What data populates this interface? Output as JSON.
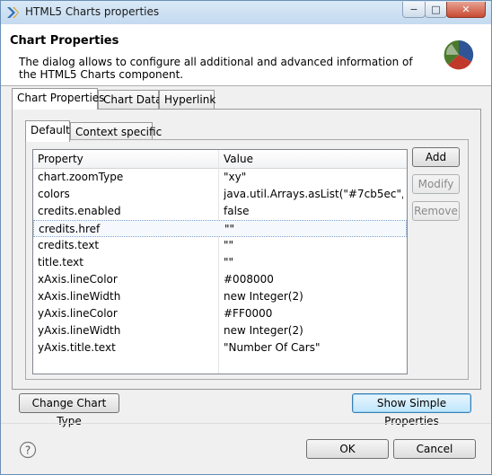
{
  "window": {
    "title": "HTML5 Charts properties",
    "minimize_label": "−",
    "maximize_label": "□",
    "close_label": "✕"
  },
  "header": {
    "title": "Chart Properties",
    "description": "The dialog allows to configure all additional and advanced information of the HTML5 Charts component."
  },
  "main_tabs": [
    {
      "label": "Chart Properties",
      "active": true
    },
    {
      "label": "Chart Data",
      "active": false
    },
    {
      "label": "Hyperlink",
      "active": false
    }
  ],
  "sub_tabs": [
    {
      "label": "Default",
      "active": true
    },
    {
      "label": "Context specific",
      "active": false
    }
  ],
  "table": {
    "columns": [
      "Property",
      "Value"
    ],
    "rows": [
      {
        "property": "chart.zoomType",
        "value": "\"xy\""
      },
      {
        "property": "colors",
        "value": "java.util.Arrays.asList(\"#7cb5ec\",\"#..."
      },
      {
        "property": "credits.enabled",
        "value": "false"
      },
      {
        "property": "credits.href",
        "value": "\"\""
      },
      {
        "property": "credits.text",
        "value": "\"\""
      },
      {
        "property": "title.text",
        "value": "\"\""
      },
      {
        "property": "xAxis.lineColor",
        "value": "#008000"
      },
      {
        "property": "xAxis.lineWidth",
        "value": "new Integer(2)"
      },
      {
        "property": "yAxis.lineColor",
        "value": "#FF0000"
      },
      {
        "property": "yAxis.lineWidth",
        "value": "new Integer(2)"
      },
      {
        "property": "yAxis.title.text",
        "value": "\"Number Of Cars\""
      }
    ],
    "selected_row": 3
  },
  "side_buttons": {
    "add": "Add",
    "modify": "Modify",
    "remove": "Remove"
  },
  "buttons": {
    "change_chart_type": "Change Chart Type",
    "show_simple_properties": "Show Simple Properties",
    "ok": "OK",
    "cancel": "Cancel"
  },
  "colors": {
    "accent": "#3c7fb1",
    "pie_blue": "#2f5597",
    "pie_red": "#c0392b",
    "pie_green": "#4a7a2a"
  }
}
